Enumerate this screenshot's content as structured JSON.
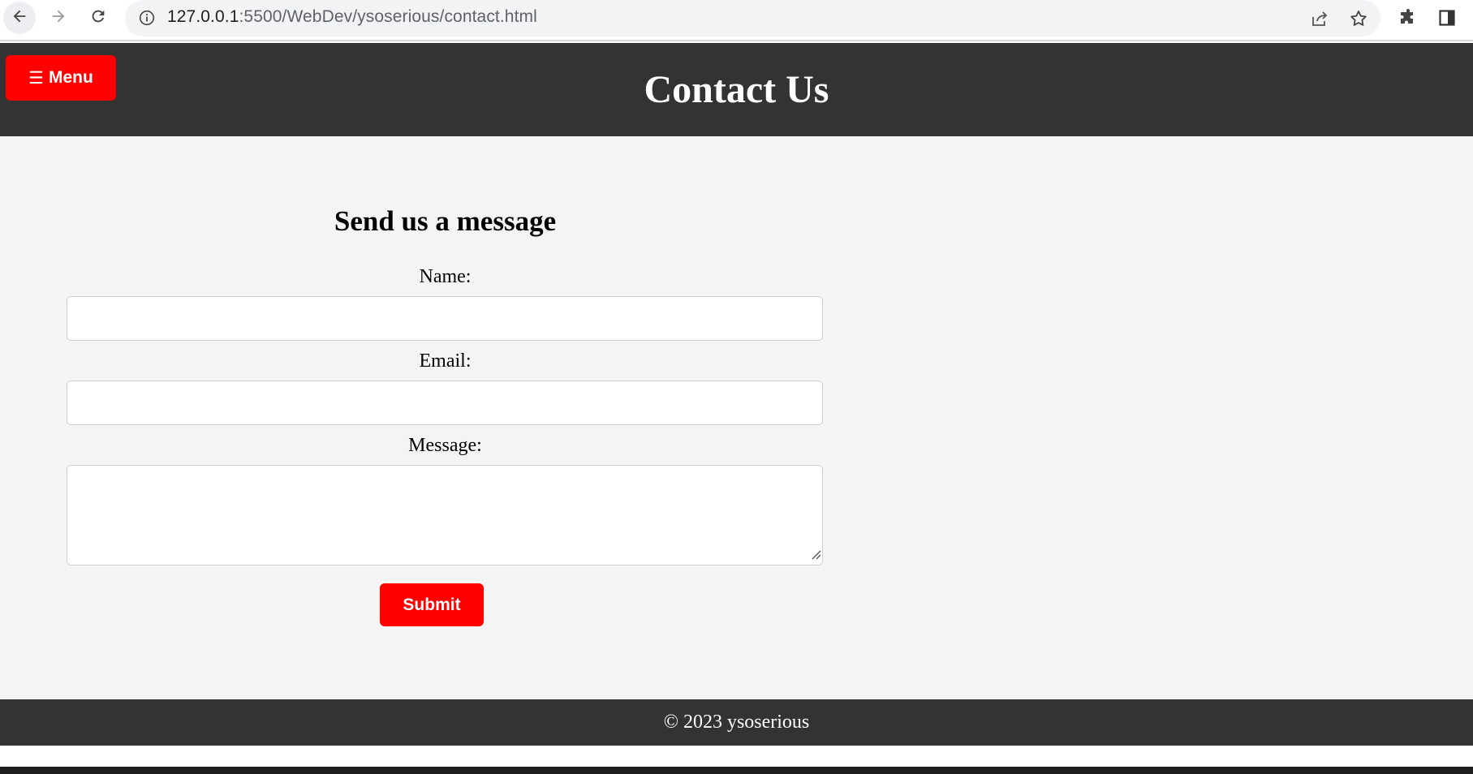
{
  "browser": {
    "url_host": "127.0.0.1",
    "url_rest": ":5500/WebDev/ysoserious/contact.html",
    "icons": {
      "back": "back-arrow-icon",
      "forward": "forward-arrow-icon",
      "reload": "reload-icon",
      "info": "info-icon",
      "share": "share-icon",
      "bookmark": "star-icon",
      "extensions": "puzzle-icon",
      "side_panel": "side-panel-icon"
    }
  },
  "header": {
    "menu_glyph": "☰",
    "menu_label": "Menu",
    "title": "Contact Us"
  },
  "form": {
    "heading": "Send us a message",
    "name_label": "Name:",
    "name_value": "",
    "email_label": "Email:",
    "email_value": "",
    "message_label": "Message:",
    "message_value": "",
    "submit_label": "Submit"
  },
  "footer": {
    "text": "© 2023 ysoserious"
  },
  "colors": {
    "header_bg": "#333333",
    "page_bg": "#f4f4f4",
    "accent_red": "#ff0000",
    "text_white": "#ffffff"
  }
}
